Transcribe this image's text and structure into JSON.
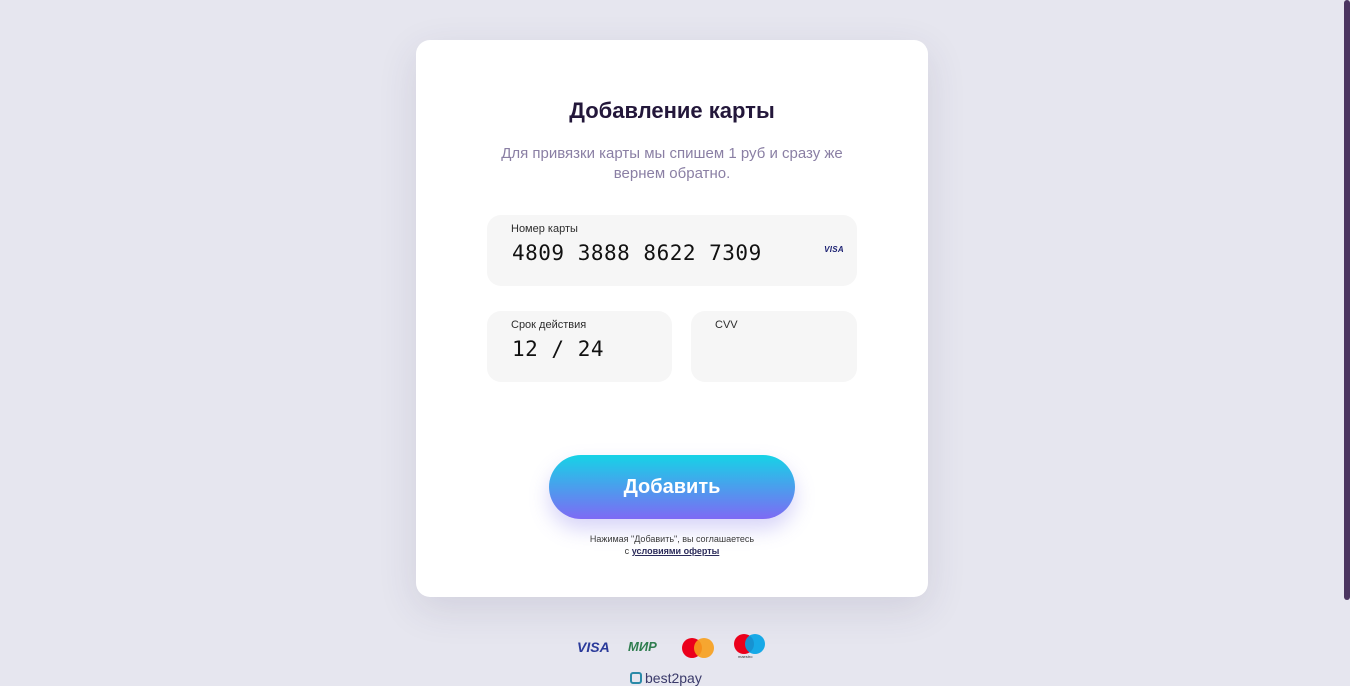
{
  "modal": {
    "title": "Добавление карты",
    "subtitle": "Для привязки карты мы спишем 1 руб и сразу же вернем обратно.",
    "card_number": {
      "label": "Номер карты",
      "value": "4809 3888 8622 7309",
      "brand": "VISA"
    },
    "expiry": {
      "label": "Срок действия",
      "value": "12 / 24"
    },
    "cvv": {
      "label": "CVV",
      "value": ""
    },
    "add_button": "Добавить",
    "terms_text": "Нажимая \"Добавить\", вы соглашаетесь",
    "terms_prefix": "с",
    "terms_link": "условиями оферты"
  },
  "footer": {
    "payment_logos": [
      "VISA",
      "МИР",
      "mastercard",
      "maestro"
    ],
    "logo_text": {
      "visa": "VISA",
      "mir": "МИР",
      "maestro": "maestro"
    },
    "brand": "best2pay"
  },
  "colors": {
    "background": "#e6e6ef",
    "button_gradient_top": "#16d3e6",
    "button_gradient_bottom": "#7e6af4",
    "title": "#23173a",
    "subtitle": "#8a7fa4"
  }
}
